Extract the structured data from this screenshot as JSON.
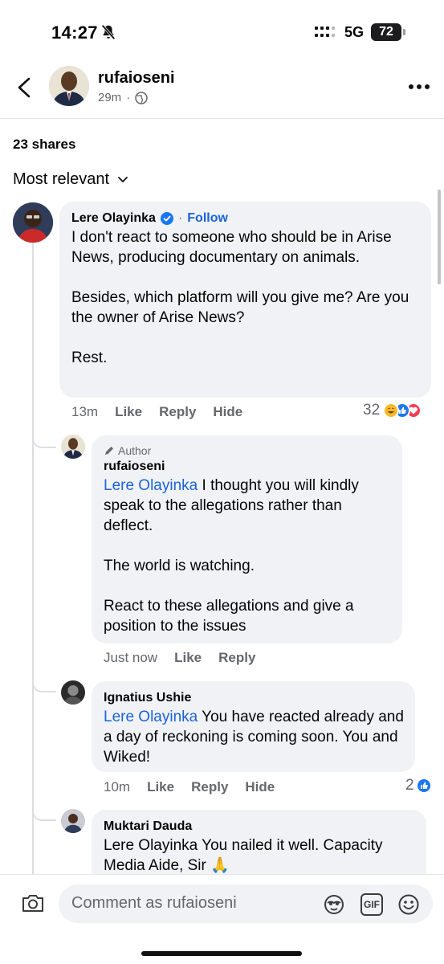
{
  "status": {
    "time": "14:27",
    "network": "5G",
    "battery": "72"
  },
  "header": {
    "name": "rufaioseni",
    "time": "29m",
    "dot": "·"
  },
  "shares": "23 shares",
  "sort_label": "Most relevant",
  "comments": [
    {
      "name": "Lere Olayinka",
      "separator": "·",
      "follow": "Follow",
      "text": "I don't react to someone who should be in Arise News, producing documentary on animals.\n\nBesides, which platform will you give me? Are you the owner of Arise News?\n\nRest.",
      "time": "13m",
      "like": "Like",
      "reply": "Reply",
      "hide": "Hide",
      "reactions": "32"
    },
    {
      "tag": "Author",
      "name": "rufaioseni",
      "mention": "Lere Olayinka",
      "text": " I thought you will kindly speak to the allegations rather than deflect.\n\nThe world is watching.\n\nReact to these allegations and give a position to the issues",
      "time": "Just now",
      "like": "Like",
      "reply": "Reply"
    },
    {
      "name": "Ignatius Ushie",
      "mention": "Lere Olayinka",
      "text": " You have reacted already and a day of reckoning is coming soon. You and Wiked!",
      "time": "10m",
      "like": "Like",
      "reply": "Reply",
      "hide": "Hide",
      "reactions": "2"
    },
    {
      "name": "Muktari Dauda",
      "text": "Lere Olayinka You nailed it well. Capacity Media Aide, Sir 🙏"
    }
  ],
  "composer": {
    "placeholder": "Comment as rufaioseni",
    "gif": "GIF"
  },
  "colors": {
    "link": "#1b63d8",
    "bubble": "#f0f2f5",
    "muted": "#65676b",
    "like_blue": "#1877f2",
    "love_red": "#f33e58",
    "haha_yellow": "#f7b928"
  },
  "icons": [
    "bell-slash-icon",
    "signal-icon",
    "back-arrow-icon",
    "globe-icon",
    "more-icon",
    "chevron-down-icon",
    "verified-icon",
    "pencil-icon",
    "camera-icon",
    "avatar-sticker-icon",
    "gif-icon",
    "emoji-icon"
  ]
}
